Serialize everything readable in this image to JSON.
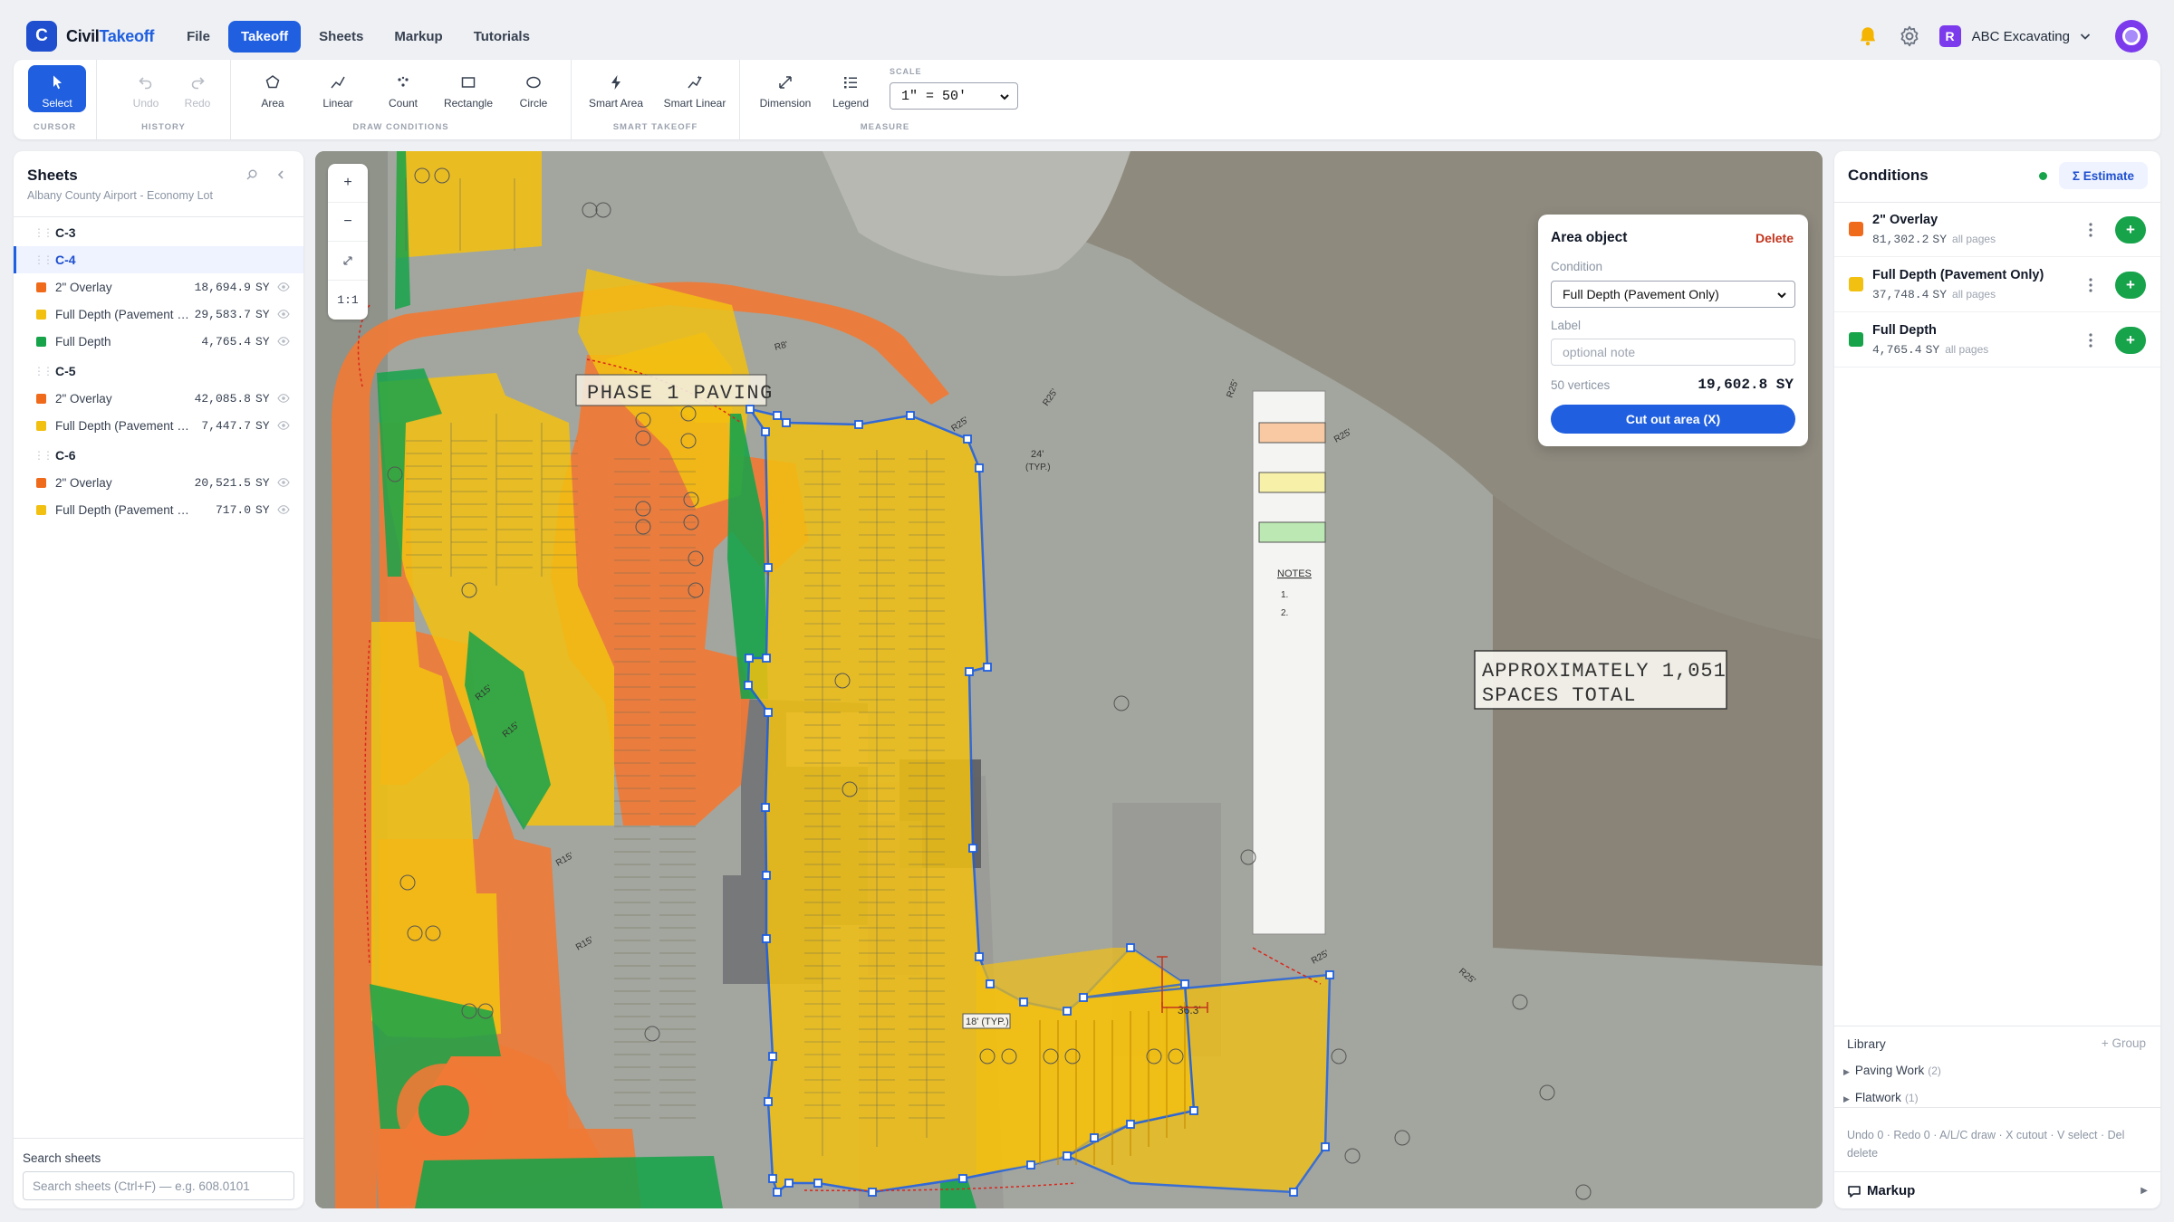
{
  "app": {
    "logo_letter": "C",
    "name_part1": "Civil",
    "name_part2": "Takeoff"
  },
  "menu": {
    "items": [
      {
        "label": "File",
        "active": false
      },
      {
        "label": "Takeoff",
        "active": true
      },
      {
        "label": "Sheets",
        "active": false
      },
      {
        "label": "Markup",
        "active": false
      },
      {
        "label": "Tutorials",
        "active": false
      }
    ]
  },
  "account": {
    "org_initial": "R",
    "org_name": "ABC Excavating"
  },
  "toolbar": {
    "groups": {
      "cursor": "CURSOR",
      "history": "HISTORY",
      "draw": "DRAW CONDITIONS",
      "smart": "SMART TAKEOFF",
      "measure": "MEASURE"
    },
    "select": "Select",
    "undo": "Undo",
    "redo": "Redo",
    "area": "Area",
    "linear": "Linear",
    "count": "Count",
    "rectangle": "Rectangle",
    "circle": "Circle",
    "smart_area": "Smart Area",
    "smart_linear": "Smart Linear",
    "dimension": "Dimension",
    "legend": "Legend",
    "scale_label": "SCALE",
    "scale_value": "1\" = 50'"
  },
  "sheets_panel": {
    "title": "Sheets",
    "project": "Albany County Airport - Economy Lot",
    "rows": [
      {
        "type": "sheet",
        "name": "C-3",
        "active": false
      },
      {
        "type": "sheet",
        "name": "C-4",
        "active": true
      },
      {
        "type": "cond",
        "name": "2\" Overlay",
        "value": "18,694.9",
        "unit": "SY",
        "color": "#f06a1c"
      },
      {
        "type": "cond",
        "name": "Full Depth (Pavement Only)",
        "value": "29,583.7",
        "unit": "SY",
        "color": "#f2c011"
      },
      {
        "type": "cond",
        "name": "Full Depth",
        "value": "4,765.4",
        "unit": "SY",
        "color": "#16a34a"
      },
      {
        "type": "sheet",
        "name": "C-5",
        "active": false
      },
      {
        "type": "cond",
        "name": "2\" Overlay",
        "value": "42,085.8",
        "unit": "SY",
        "color": "#f06a1c"
      },
      {
        "type": "cond",
        "name": "Full Depth (Pavement Only)",
        "value": "7,447.7",
        "unit": "SY",
        "color": "#f2c011"
      },
      {
        "type": "sheet",
        "name": "C-6",
        "active": false
      },
      {
        "type": "cond",
        "name": "2\" Overlay",
        "value": "20,521.5",
        "unit": "SY",
        "color": "#f06a1c"
      },
      {
        "type": "cond",
        "name": "Full Depth (Pavement Only)",
        "value": "717.0",
        "unit": "SY",
        "color": "#f2c011"
      }
    ],
    "search_label": "Search sheets",
    "search_placeholder": "Search sheets (Ctrl+F) — e.g. 608.0101"
  },
  "map": {
    "zoom_in": "+",
    "zoom_out": "−",
    "reset": "1:1",
    "labels": {
      "phase": "PHASE 1 PAVING",
      "approx_line1": "APPROXIMATELY 1,051",
      "approx_line2": "SPACES TOTAL",
      "typ24": "24'",
      "typ": "(TYP.)",
      "typ18": "18' (TYP.)",
      "dim363": "36.3'",
      "notes": "NOTES",
      "r25": "R25'",
      "r15": "R15'",
      "r8": "R8'"
    }
  },
  "popup": {
    "title": "Area object",
    "delete": "Delete",
    "condition_label": "Condition",
    "condition_value": "Full Depth (Pavement Only)",
    "label_label": "Label",
    "label_placeholder": "optional note",
    "vertices": "50 vertices",
    "area": "19,602.8 SY",
    "cut_button": "Cut out area (X)"
  },
  "conditions_panel": {
    "title": "Conditions",
    "estimate": "Σ Estimate",
    "items": [
      {
        "name": "2\" Overlay",
        "value": "81,302.2",
        "unit": "SY",
        "scope": "all pages",
        "color": "#f06a1c"
      },
      {
        "name": "Full Depth (Pavement Only)",
        "value": "37,748.4",
        "unit": "SY",
        "scope": "all pages",
        "color": "#f2c011"
      },
      {
        "name": "Full Depth",
        "value": "4,765.4",
        "unit": "SY",
        "scope": "all pages",
        "color": "#16a34a"
      }
    ],
    "add_label": "+",
    "library_title": "Library",
    "add_group": "+ Group",
    "library_items": [
      {
        "name": "Paving Work",
        "count": "(2)"
      },
      {
        "name": "Flatwork",
        "count": "(1)"
      }
    ],
    "hint": "Undo 0 · Redo 0 · A/L/C draw · X cutout · V select · Del delete",
    "markup": "Markup"
  }
}
